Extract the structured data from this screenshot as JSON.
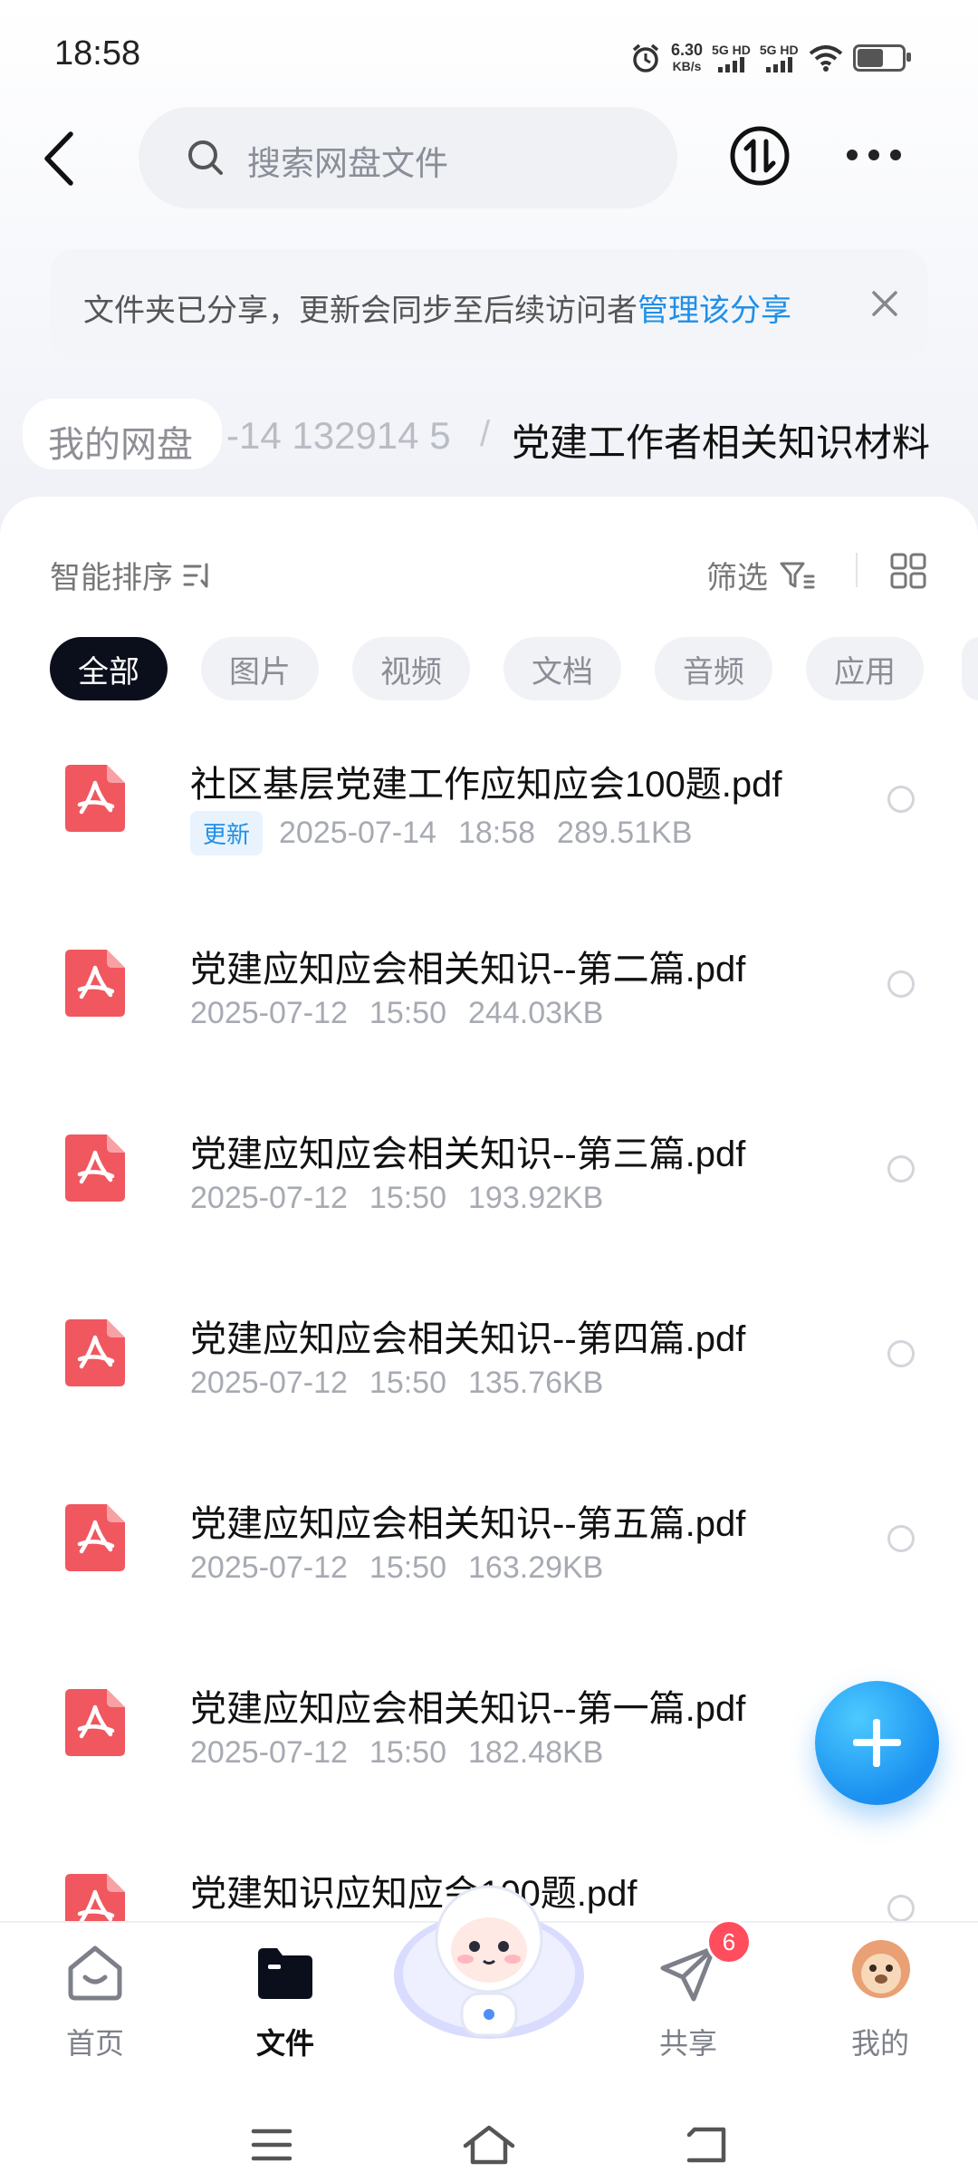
{
  "status": {
    "time": "18:58",
    "net_speed_value": "6.30",
    "net_speed_unit": "KB/s",
    "sim1": "5G HD",
    "sim2": "5G HD"
  },
  "header": {
    "search_placeholder": "搜索网盘文件"
  },
  "banner": {
    "text": "文件夹已分享，更新会同步至后续访问者",
    "link": "管理该分享"
  },
  "breadcrumb": {
    "home": "我的网盘",
    "middle": "-14 132914 5",
    "separator": "/",
    "current": "党建工作者相关知识材料"
  },
  "toolbar": {
    "sort_label": "智能排序",
    "filter_label": "筛选"
  },
  "chips": [
    "全部",
    "图片",
    "视频",
    "文档",
    "音频",
    "应用"
  ],
  "files": [
    {
      "name": "社区基层党建工作应知应会100题.pdf",
      "tag": "更新",
      "date": "2025-07-14",
      "time": "18:58",
      "size": "289.51KB"
    },
    {
      "name": "党建应知应会相关知识--第二篇.pdf",
      "tag": "",
      "date": "2025-07-12",
      "time": "15:50",
      "size": "244.03KB"
    },
    {
      "name": "党建应知应会相关知识--第三篇.pdf",
      "tag": "",
      "date": "2025-07-12",
      "time": "15:50",
      "size": "193.92KB"
    },
    {
      "name": "党建应知应会相关知识--第四篇.pdf",
      "tag": "",
      "date": "2025-07-12",
      "time": "15:50",
      "size": "135.76KB"
    },
    {
      "name": "党建应知应会相关知识--第五篇.pdf",
      "tag": "",
      "date": "2025-07-12",
      "time": "15:50",
      "size": "163.29KB"
    },
    {
      "name": "党建应知应会相关知识--第一篇.pdf",
      "tag": "",
      "date": "2025-07-12",
      "time": "15:50",
      "size": "182.48KB"
    },
    {
      "name": "党建知识应知应会100题.pdf",
      "tag": "",
      "date": "",
      "time": "",
      "size": ""
    }
  ],
  "nav": {
    "home": "首页",
    "files": "文件",
    "share": "共享",
    "share_badge": "6",
    "mine": "我的"
  },
  "colors": {
    "accent": "#1f8fe8",
    "pdf_red": "#f0575f",
    "badge_red": "#ff4d5e"
  }
}
